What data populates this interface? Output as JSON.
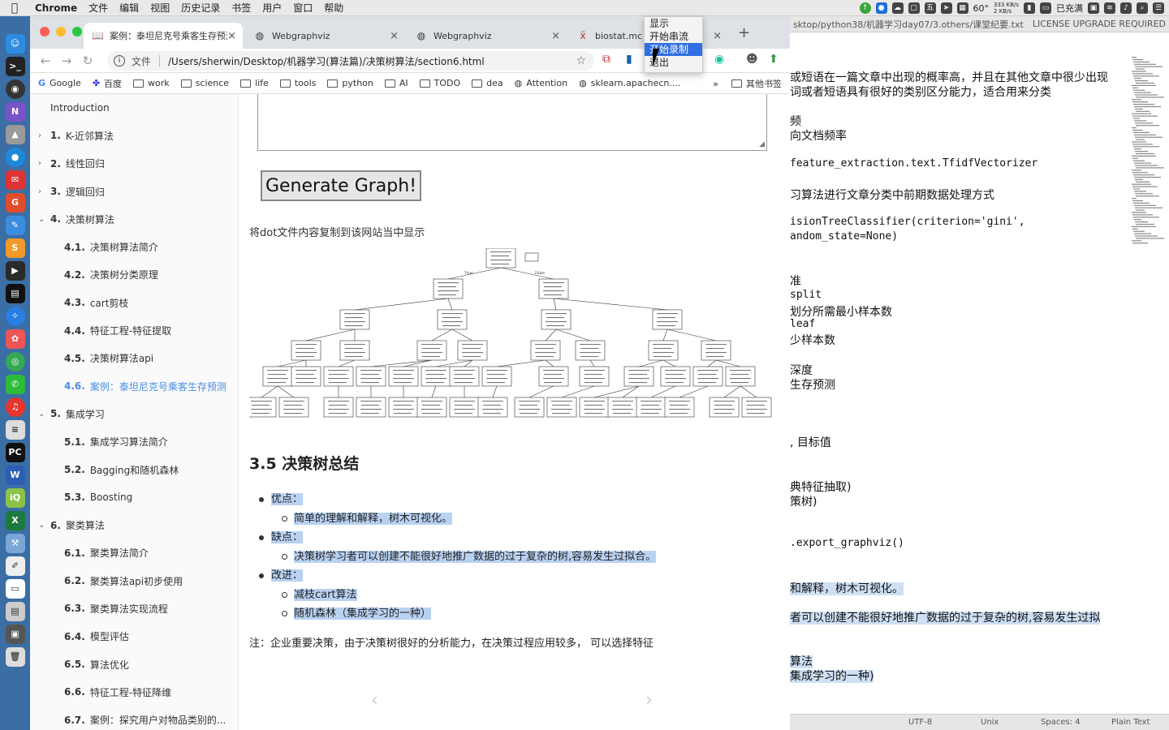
{
  "menubar": {
    "items": [
      "Chrome",
      "文件",
      "编辑",
      "视图",
      "历史记录",
      "书签",
      "用户",
      "窗口",
      "帮助"
    ],
    "tray": {
      "temp": "60°",
      "net_up": "333 KB/s",
      "net_down": "2 KB/s",
      "battery": "已充满"
    }
  },
  "browser": {
    "tabs": [
      {
        "title": "案例：泰坦尼克号乘客生存预测",
        "icon": "book-icon"
      },
      {
        "title": "Webgraphviz",
        "icon": "globe-icon"
      },
      {
        "title": "Webgraphviz",
        "icon": "globe-icon"
      },
      {
        "title": "biostat.mc",
        "icon": "medical-icon"
      }
    ],
    "address": {
      "label": "文件",
      "url": "/Users/sherwin/Desktop/机器学习(算法篇)/决策树算法/section6.html"
    },
    "bookmarks": [
      "Google",
      "百度",
      "work",
      "science",
      "life",
      "tools",
      "python",
      "AI",
      "TODO",
      "dea",
      "Attention",
      "sklearn.apachecn...."
    ],
    "bookmarks_more": "»",
    "bookmarks_other": "其他书签"
  },
  "popup_menu": {
    "items": [
      "显示",
      "开始串流",
      "开始录制",
      "退出"
    ],
    "selected": 2
  },
  "sidebar": {
    "items": [
      {
        "num": "",
        "label": "Introduction",
        "level": 0,
        "chev": ""
      },
      {
        "num": "1.",
        "label": "K-近邻算法",
        "level": 1,
        "chev": "›"
      },
      {
        "num": "2.",
        "label": "线性回归",
        "level": 1,
        "chev": "›"
      },
      {
        "num": "3.",
        "label": "逻辑回归",
        "level": 1,
        "chev": "›"
      },
      {
        "num": "4.",
        "label": "决策树算法",
        "level": 1,
        "chev": "⌄"
      },
      {
        "num": "4.1.",
        "label": "决策树算法简介",
        "level": 2,
        "chev": ""
      },
      {
        "num": "4.2.",
        "label": "决策树分类原理",
        "level": 2,
        "chev": ""
      },
      {
        "num": "4.3.",
        "label": "cart剪枝",
        "level": 2,
        "chev": ""
      },
      {
        "num": "4.4.",
        "label": "特征工程-特征提取",
        "level": 2,
        "chev": ""
      },
      {
        "num": "4.5.",
        "label": "决策树算法api",
        "level": 2,
        "chev": ""
      },
      {
        "num": "4.6.",
        "label": "案例：泰坦尼克号乘客生存预测",
        "level": 2,
        "chev": "",
        "active": true
      },
      {
        "num": "5.",
        "label": "集成学习",
        "level": 1,
        "chev": "⌄"
      },
      {
        "num": "5.1.",
        "label": "集成学习算法简介",
        "level": 2,
        "chev": ""
      },
      {
        "num": "5.2.",
        "label": "Bagging和随机森林",
        "level": 2,
        "chev": ""
      },
      {
        "num": "5.3.",
        "label": "Boosting",
        "level": 2,
        "chev": ""
      },
      {
        "num": "6.",
        "label": "聚类算法",
        "level": 1,
        "chev": "⌄"
      },
      {
        "num": "6.1.",
        "label": "聚类算法简介",
        "level": 2,
        "chev": ""
      },
      {
        "num": "6.2.",
        "label": "聚类算法api初步使用",
        "level": 2,
        "chev": ""
      },
      {
        "num": "6.3.",
        "label": "聚类算法实现流程",
        "level": 2,
        "chev": ""
      },
      {
        "num": "6.4.",
        "label": "模型评估",
        "level": 2,
        "chev": ""
      },
      {
        "num": "6.5.",
        "label": "算法优化",
        "level": 2,
        "chev": ""
      },
      {
        "num": "6.6.",
        "label": "特征工程-特征降维",
        "level": 2,
        "chev": ""
      },
      {
        "num": "6.7.",
        "label": "案例：探究用户对物品类别的...",
        "level": 2,
        "chev": ""
      }
    ]
  },
  "main": {
    "generate_button": "Generate Graph!",
    "description": "将dot文件内容复制到该网站当中显示",
    "tree_edge_labels": {
      "true": "True",
      "false": "False"
    },
    "section_title": "3.5 决策树总结",
    "bullets": [
      {
        "level": 1,
        "text": "优点："
      },
      {
        "level": 2,
        "text": "简单的理解和解释，树木可视化。"
      },
      {
        "level": 1,
        "text": "缺点："
      },
      {
        "level": 2,
        "text": "决策树学习者可以创建不能很好地推广数据的过于复杂的树,容易发生过拟合。"
      },
      {
        "level": 1,
        "text": "改进："
      },
      {
        "level": 2,
        "text": "减枝cart算法"
      },
      {
        "level": 2,
        "text": "随机森林（集成学习的一种）"
      }
    ],
    "note": "注：企业重要决策，由于决策树很好的分析能力，在决策过程应用较多， 可以选择特征",
    "prev": "‹",
    "next": "›"
  },
  "editor": {
    "title_path": "sktop/python38/机器学习day07/3.others/课堂纪要.txt",
    "license": "LICENSE UPGRADE REQUIRED",
    "lines": [
      {
        "text": "或短语在一篇文章中出现的概率高，并且在其他文章中很少出现",
        "mono": false
      },
      {
        "text": "词或者短语具有很好的类别区分能力，适合用来分类",
        "mono": false
      },
      {
        "text": "频",
        "mono": false
      },
      {
        "text": "向文档频率",
        "mono": false
      },
      {
        "text": "feature_extraction.text.TfidfVectorizer",
        "mono": true
      },
      {
        "text": "习算法进行文章分类中前期数据处理方式",
        "mono": false
      },
      {
        "text": "isionTreeClassifier(criterion='gini',",
        "mono": true
      },
      {
        "text": "andom_state=None)",
        "mono": true
      },
      {
        "text": "准",
        "mono": false
      },
      {
        "text": "split",
        "mono": true
      },
      {
        "text": "划分所需最小样本数",
        "mono": false
      },
      {
        "text": "leaf",
        "mono": true
      },
      {
        "text": "少样本数",
        "mono": false
      },
      {
        "text": "深度",
        "mono": false
      },
      {
        "text": "生存预测",
        "mono": false
      },
      {
        "text": ", 目标值",
        "mono": false
      },
      {
        "text": "典特征抽取)",
        "mono": false
      },
      {
        "text": "策树)",
        "mono": false
      },
      {
        "text": ".export_graphviz()",
        "mono": true
      },
      {
        "text": "和解释，树木可视化。",
        "mono": false
      },
      {
        "text": "者可以创建不能很好地推广数据的过于复杂的树,容易发生过拟",
        "mono": false
      },
      {
        "text": "算法",
        "mono": false
      },
      {
        "text": "集成学习的一种)",
        "mono": false
      }
    ],
    "status": {
      "encoding": "UTF-8",
      "line_endings": "Unix",
      "indent": "Spaces: 4",
      "syntax": "Plain Text"
    }
  }
}
